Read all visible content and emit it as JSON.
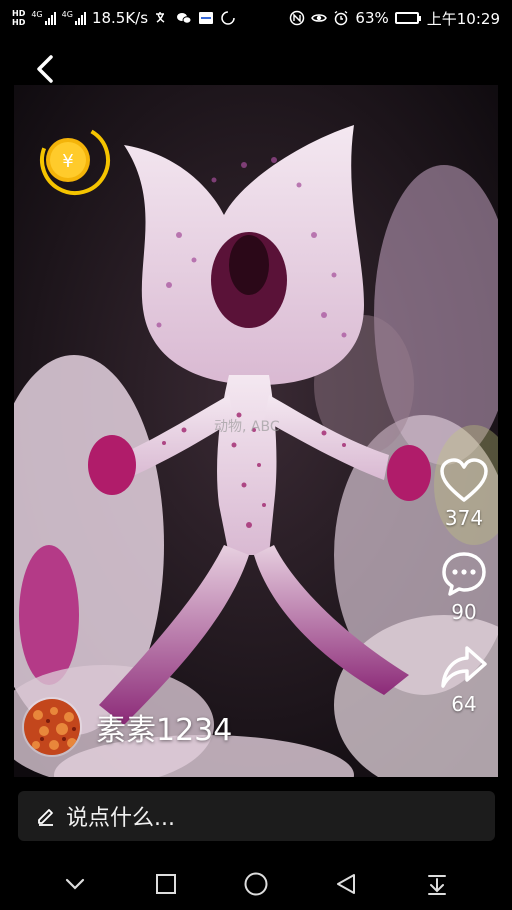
{
  "status_bar": {
    "hd_label": "HD",
    "net_label_1": "4G",
    "net_label_2": "4G",
    "speed": "18.5K/s",
    "battery_percent": "63%",
    "battery_level": 0.63,
    "time": "上午10:29"
  },
  "post": {
    "watermark": "动物, ABC",
    "likes": "374",
    "comments": "90",
    "shares": "64"
  },
  "author": {
    "name": "素素1234"
  },
  "comment_bar": {
    "placeholder": "说点什么..."
  }
}
